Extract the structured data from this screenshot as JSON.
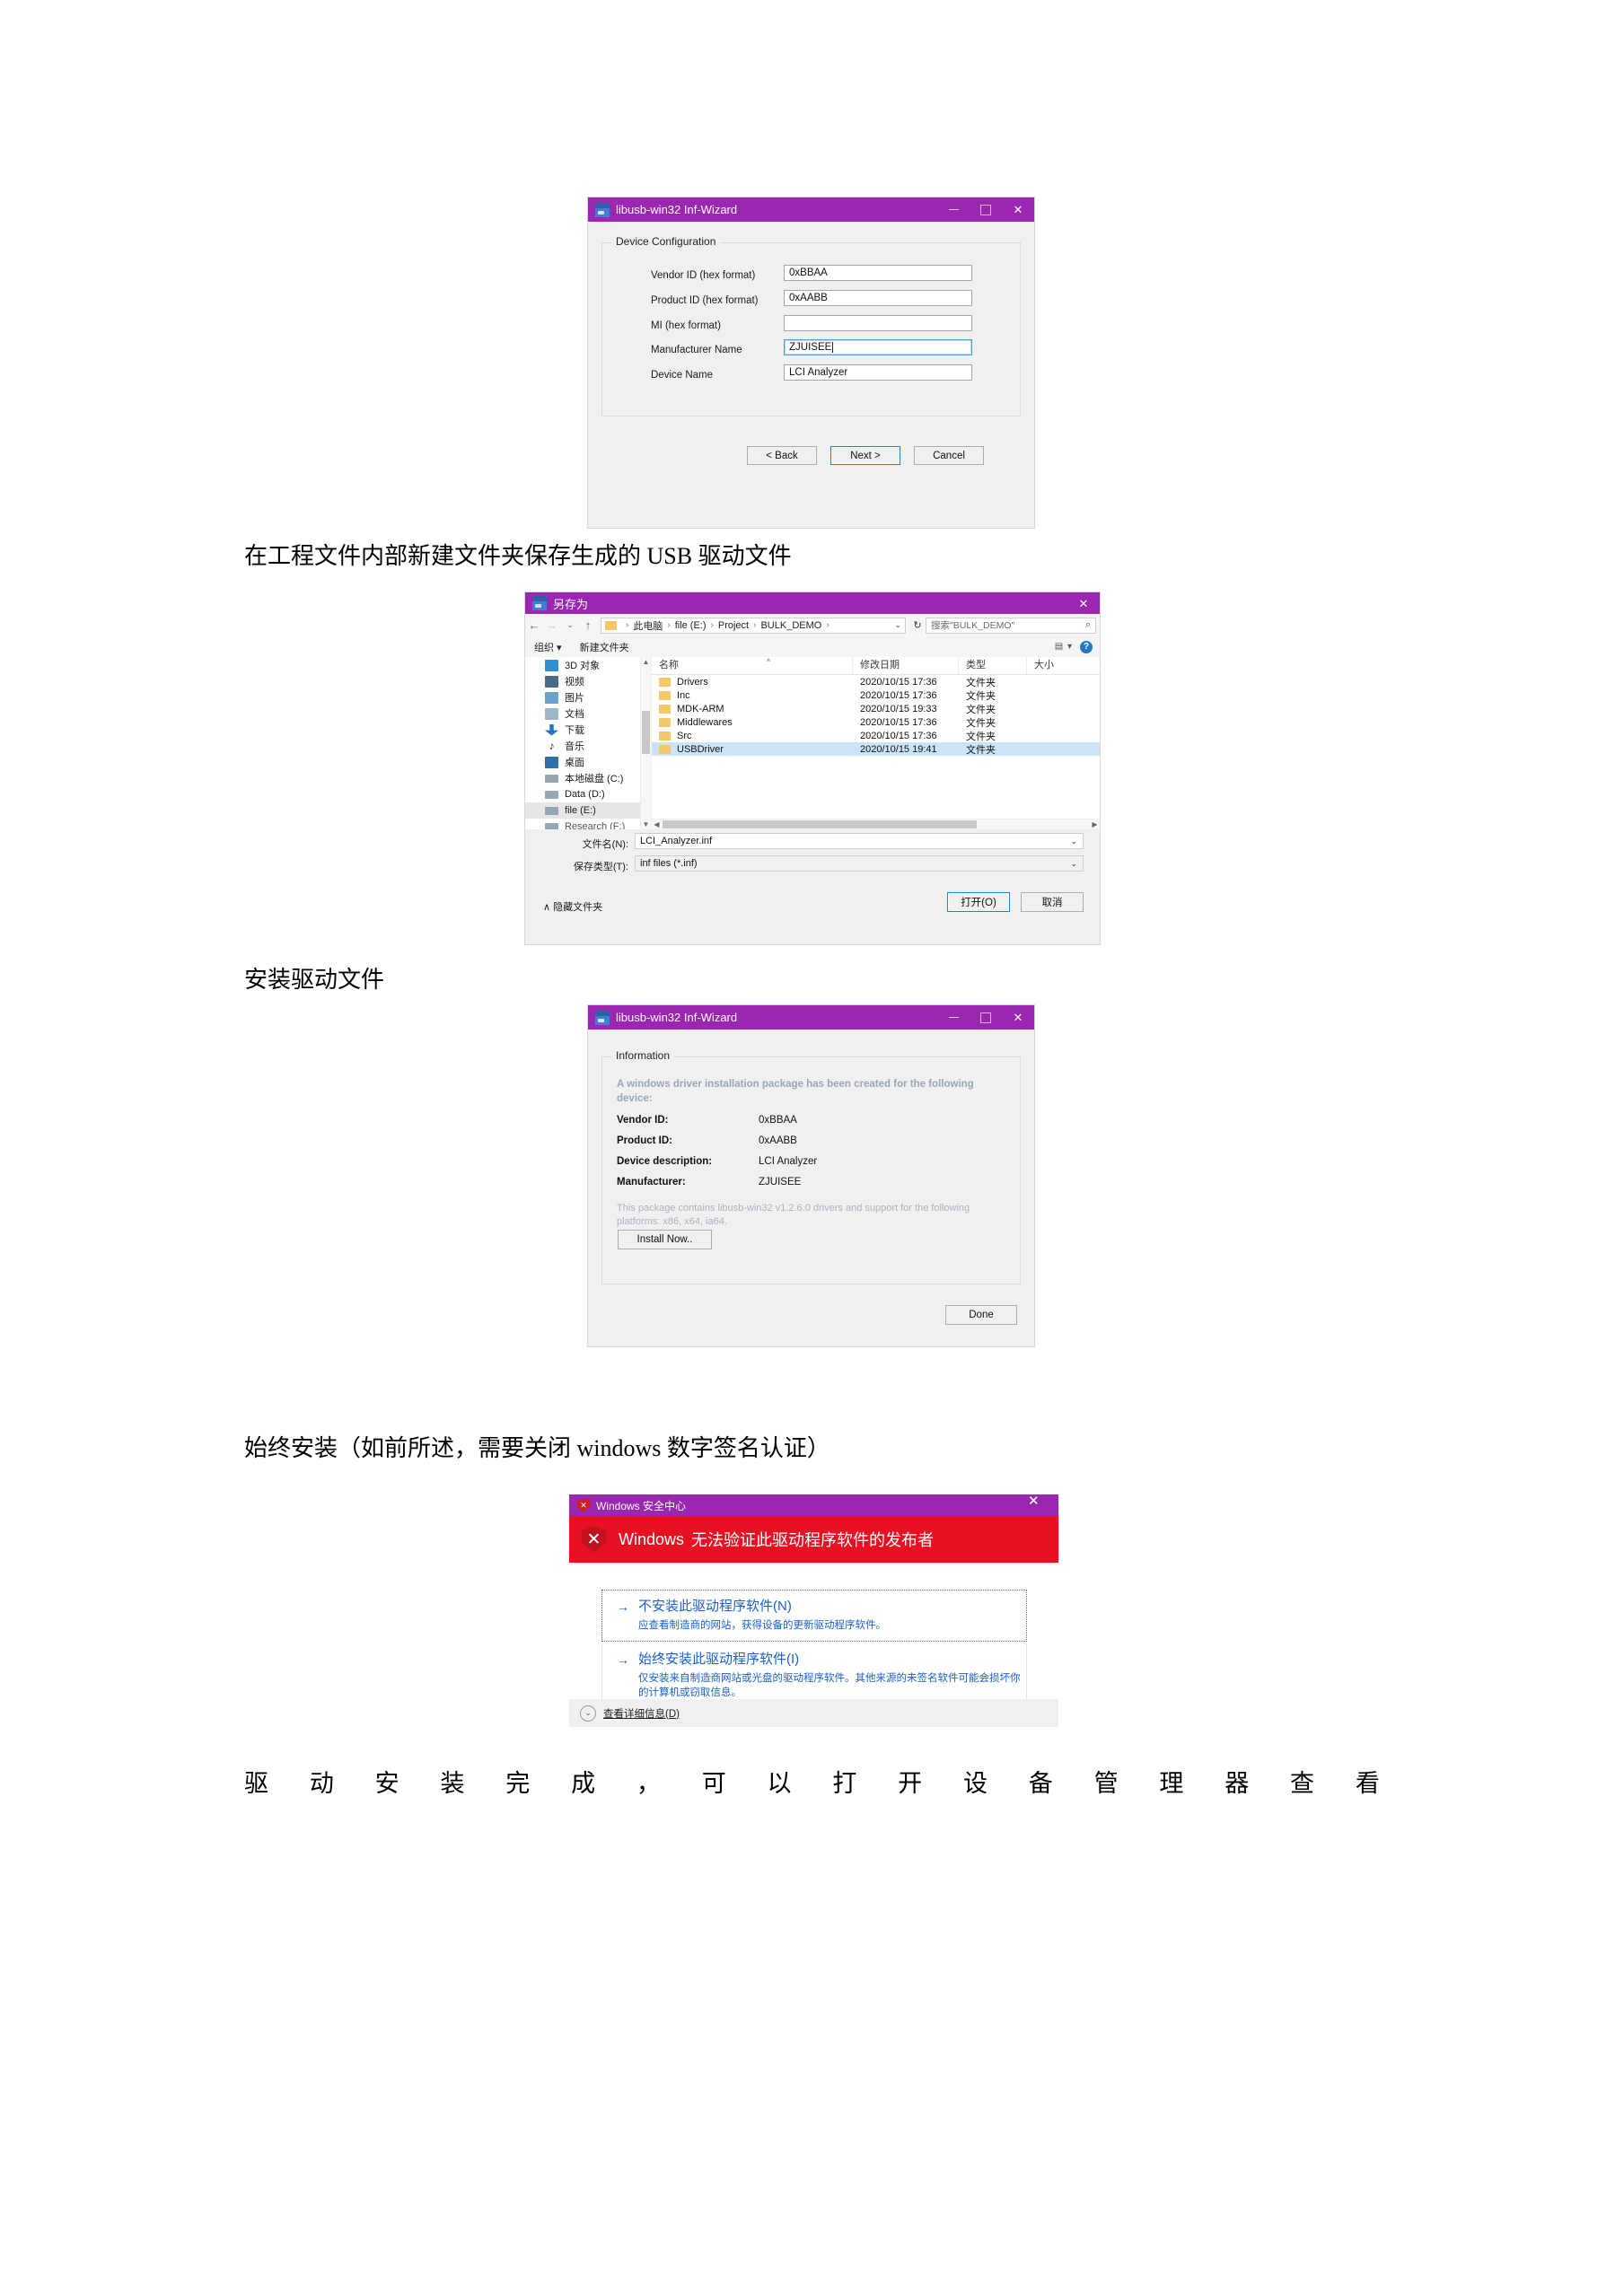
{
  "document": {
    "paragraphs": [
      {
        "id": "p1",
        "text": "在工程文件内部新建文件夹保存生成的 USB 驱动文件"
      },
      {
        "id": "p2",
        "text": "安装驱动文件"
      },
      {
        "id": "p3",
        "text": "始终安装（如前所述，需要关闭 windows 数字签名认证）"
      }
    ],
    "justified_line": [
      "驱",
      "动",
      "安",
      "装",
      "完",
      "成",
      "，",
      "可",
      "以",
      "打",
      "开",
      "设",
      "备",
      "管",
      "理",
      "器",
      "查",
      "看"
    ]
  },
  "inf_wizard_config": {
    "title": "libusb-win32 Inf-Wizard",
    "window_icon": "inf-wizard-icon",
    "minimize_label": "—",
    "maximize_label": "□",
    "close_label": "✕",
    "group_label": "Device Configuration",
    "fields": [
      {
        "label": "Vendor ID (hex format)",
        "value": "0xBBAA",
        "focused": false
      },
      {
        "label": "Product ID (hex format)",
        "value": "0xAABB",
        "focused": false
      },
      {
        "label": "MI (hex format)",
        "value": "",
        "focused": false
      },
      {
        "label": "Manufacturer Name",
        "value": "ZJUISEE",
        "focused": true
      },
      {
        "label": "Device Name",
        "value": "LCI Analyzer",
        "focused": false
      }
    ],
    "buttons": {
      "back": "< Back",
      "next": "Next >",
      "cancel": "Cancel"
    }
  },
  "save_as": {
    "title": "另存为",
    "window_icon": "inf-wizard-icon",
    "close_label": "✕",
    "nav": {
      "back_icon": "arrow-left-icon",
      "forward_icon": "arrow-right-icon",
      "recent_icon": "chevron-down-icon",
      "up_icon": "arrow-up-icon",
      "breadcrumb": [
        "此电脑",
        "file (E:)",
        "Project",
        "BULK_DEMO"
      ],
      "breadcrumb_sep": "›",
      "refresh_icon": "refresh-icon",
      "search_placeholder": "搜索\"BULK_DEMO\"",
      "search_icon": "search-icon"
    },
    "command_bar": {
      "organize": "组织 ▾",
      "new_folder": "新建文件夹",
      "view_icon": "view-options-icon",
      "help_icon": "help-icon"
    },
    "sidebar": [
      {
        "label": "3D 对象",
        "icon": "3d-objects-icon",
        "color": "#2f8fd0"
      },
      {
        "label": "视频",
        "icon": "videos-icon",
        "color": "#4a6b8a"
      },
      {
        "label": "图片",
        "icon": "pictures-icon",
        "color": "#6aa3c9"
      },
      {
        "label": "文档",
        "icon": "documents-icon",
        "color": "#9fb6c9"
      },
      {
        "label": "下载",
        "icon": "downloads-icon",
        "color": "#1f78c1"
      },
      {
        "label": "音乐",
        "icon": "music-icon",
        "color": "#3a3a3a"
      },
      {
        "label": "桌面",
        "icon": "desktop-icon",
        "color": "#2f6fa8"
      },
      {
        "label": "本地磁盘 (C:)",
        "icon": "drive-icon",
        "color": "#8a9aa8"
      },
      {
        "label": "Data (D:)",
        "icon": "drive-icon",
        "color": "#8a9aa8"
      },
      {
        "label": "file (E:)",
        "icon": "drive-icon",
        "color": "#8a9aa8",
        "selected": true
      },
      {
        "label": "Research (F:)",
        "icon": "drive-icon",
        "color": "#8a9aa8"
      }
    ],
    "columns": [
      "名称",
      "修改日期",
      "类型",
      "大小"
    ],
    "sort_indicator": "^",
    "rows": [
      {
        "name": "Drivers",
        "modified": "2020/10/15 17:36",
        "type": "文件夹",
        "size": "",
        "selected": false
      },
      {
        "name": "Inc",
        "modified": "2020/10/15 17:36",
        "type": "文件夹",
        "size": "",
        "selected": false
      },
      {
        "name": "MDK-ARM",
        "modified": "2020/10/15 19:33",
        "type": "文件夹",
        "size": "",
        "selected": false
      },
      {
        "name": "Middlewares",
        "modified": "2020/10/15 17:36",
        "type": "文件夹",
        "size": "",
        "selected": false
      },
      {
        "name": "Src",
        "modified": "2020/10/15 17:36",
        "type": "文件夹",
        "size": "",
        "selected": false
      },
      {
        "name": "USBDriver",
        "modified": "2020/10/15 19:41",
        "type": "文件夹",
        "size": "",
        "selected": true
      }
    ],
    "filename_label": "文件名(N):",
    "filename_value": "LCI_Analyzer.inf",
    "filetype_label": "保存类型(T):",
    "filetype_value": "inf files (*.inf)",
    "hide_folders": "∧ 隐藏文件夹",
    "open_button": "打开(O)",
    "cancel_button": "取消"
  },
  "inf_wizard_info": {
    "title": "libusb-win32 Inf-Wizard",
    "window_icon": "inf-wizard-icon",
    "minimize_label": "—",
    "maximize_label": "□",
    "close_label": "✕",
    "group_label": "Information",
    "headline": "A windows driver installation package has been created for the following device:",
    "details": [
      {
        "key": "Vendor ID:",
        "value": "0xBBAA"
      },
      {
        "key": "Product ID:",
        "value": "0xAABB"
      },
      {
        "key": "Device description:",
        "value": "LCI Analyzer"
      },
      {
        "key": "Manufacturer:",
        "value": "ZJUISEE"
      }
    ],
    "note": "This package contains libusb-win32 v1.2.6.0 drivers and support for the following platforms: x86, x64, ia64.",
    "install_button": "Install Now..",
    "done_button": "Done"
  },
  "windows_security": {
    "title": "Windows 安全中心",
    "title_icon": "security-shield-icon",
    "close_label": "✕",
    "banner_icon": "error-shield-icon",
    "banner_brand": "Windows",
    "banner_text": "无法验证此驱动程序软件的发布者",
    "options": [
      {
        "arrow": "→",
        "title": "不安装此驱动程序软件(N)",
        "desc": "应查看制造商的网站，获得设备的更新驱动程序软件。",
        "focused": true
      },
      {
        "arrow": "→",
        "title": "始终安装此驱动程序软件(I)",
        "desc": "仅安装来自制造商网站或光盘的驱动程序软件。其他来源的未签名软件可能会损坏你的计算机或窃取信息。",
        "focused": false
      }
    ],
    "details_toggle": "查看详细信息(D)",
    "details_icon": "chevron-down-circle-icon"
  },
  "colors": {
    "title_bar": "#9b26b0",
    "error_banner": "#e81123",
    "selection": "#cce4f7",
    "link": "#1b61c9",
    "folder": "#f5c96a"
  }
}
